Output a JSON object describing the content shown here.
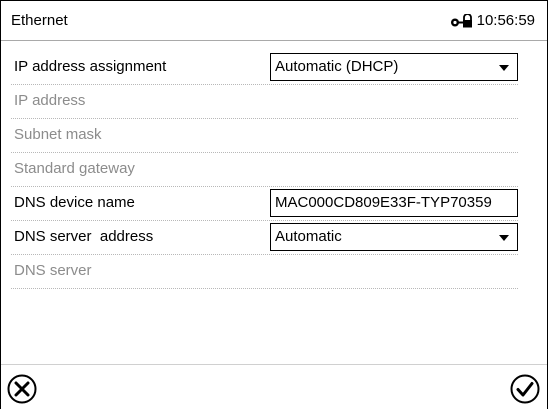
{
  "header": {
    "title": "Ethernet",
    "time": "10:56:59",
    "icon": "lock-key-icon"
  },
  "rows": [
    {
      "label": "IP address assignment",
      "control": "select",
      "value": "Automatic (DHCP)",
      "enabled": true
    },
    {
      "label": "IP address",
      "control": "none",
      "enabled": false
    },
    {
      "label": "Subnet mask",
      "control": "none",
      "enabled": false
    },
    {
      "label": "Standard gateway",
      "control": "none",
      "enabled": false
    },
    {
      "label": "DNS device name",
      "control": "text",
      "value": "MAC000CD809E33F-TYP70359",
      "enabled": true
    },
    {
      "label": "DNS server  address",
      "control": "select",
      "value": "Automatic",
      "enabled": true
    },
    {
      "label": "DNS server",
      "control": "none",
      "enabled": false
    }
  ],
  "footer": {
    "cancel_icon": "cancel-circle-x-icon",
    "confirm_icon": "confirm-circle-check-icon"
  }
}
